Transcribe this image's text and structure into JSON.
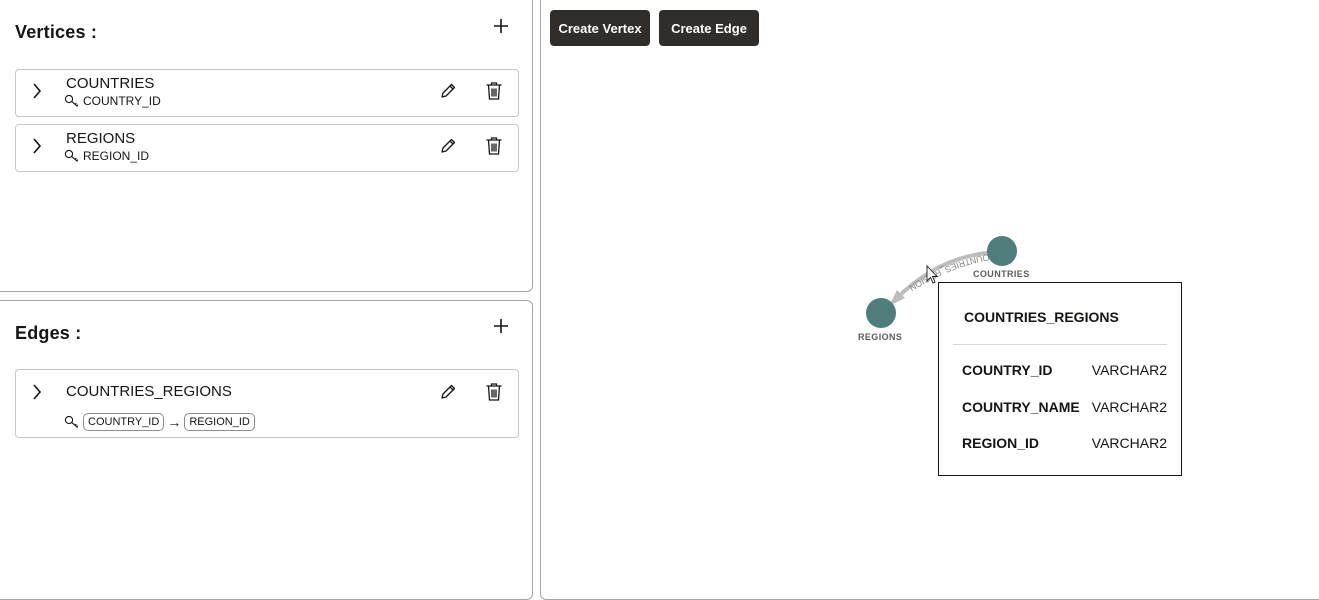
{
  "vertices_panel": {
    "title": "Vertices :",
    "add_icon": "plus-icon",
    "items": [
      {
        "name": "COUNTRIES",
        "key": "COUNTRY_ID"
      },
      {
        "name": "REGIONS",
        "key": "REGION_ID"
      }
    ]
  },
  "edges_panel": {
    "title": "Edges :",
    "add_icon": "plus-icon",
    "items": [
      {
        "name": "COUNTRIES_REGIONS",
        "source_key": "COUNTRY_ID",
        "arrow": "→",
        "target_key": "REGION_ID"
      }
    ]
  },
  "toolbar": {
    "create_vertex_label": "Create Vertex",
    "create_edge_label": "Create Edge"
  },
  "graph": {
    "nodes": [
      {
        "label": "COUNTRIES"
      },
      {
        "label": "REGIONS"
      }
    ],
    "edge_label": "COUNTRIES_REGION",
    "node_color": "#4f7d7b",
    "edge_color": "#bdbdbd"
  },
  "tooltip": {
    "title": "COUNTRIES_REGIONS",
    "columns": [
      {
        "name": "COUNTRY_ID",
        "type": "VARCHAR2"
      },
      {
        "name": "COUNTRY_NAME",
        "type": "VARCHAR2"
      },
      {
        "name": "REGION_ID",
        "type": "VARCHAR2"
      }
    ]
  },
  "icons": {
    "expand": "chevron-right-icon",
    "edit": "pencil-icon",
    "delete": "trash-icon",
    "key": "key-icon"
  }
}
